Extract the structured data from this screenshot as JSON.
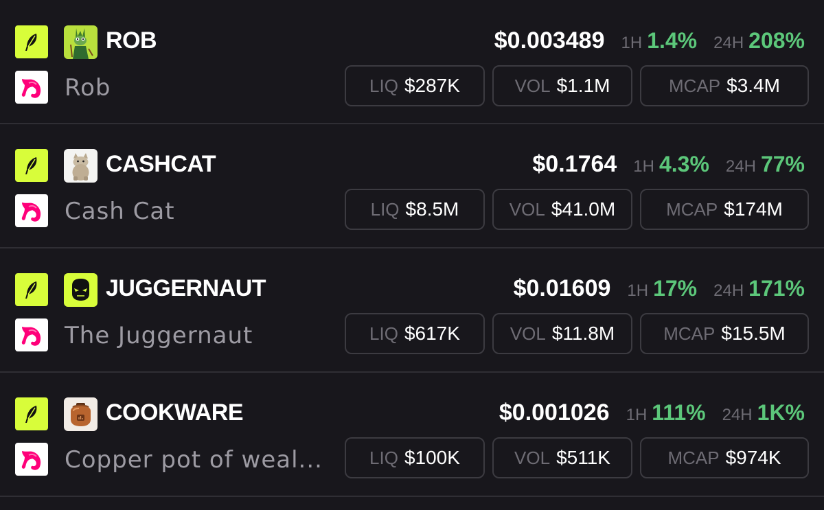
{
  "colors": {
    "background": "#18171c",
    "positive": "#5cc77a",
    "chain_badge": "#d8fd3a",
    "dex_pink": "#ff007a",
    "muted_text": "#9d9ba3"
  },
  "labels": {
    "h1": "1H",
    "h24": "24H",
    "liq": "LIQ",
    "vol": "VOL",
    "mcap": "MCAP"
  },
  "tokens": [
    {
      "symbol": "ROB",
      "name": "Rob",
      "price": "$0.003489",
      "change_1h": "1.4%",
      "change_24h": "208%",
      "liq": "$287K",
      "vol": "$1.1M",
      "mcap": "$3.4M",
      "chain_icon": "feather-icon",
      "dex_icon": "unicorn-icon",
      "avatar": "frog-archer-avatar"
    },
    {
      "symbol": "CASHCAT",
      "name": "Cash Cat",
      "price": "$0.1764",
      "change_1h": "4.3%",
      "change_24h": "77%",
      "liq": "$8.5M",
      "vol": "$41.0M",
      "mcap": "$174M",
      "chain_icon": "feather-icon",
      "dex_icon": "unicorn-icon",
      "avatar": "cat-avatar"
    },
    {
      "symbol": "JUGGERNAUT",
      "name": "The Juggernaut",
      "price": "$0.01609",
      "change_1h": "17%",
      "change_24h": "171%",
      "liq": "$617K",
      "vol": "$11.8M",
      "mcap": "$15.5M",
      "chain_icon": "feather-icon",
      "dex_icon": "unicorn-icon",
      "avatar": "juggernaut-avatar"
    },
    {
      "symbol": "COOKWARE",
      "name": "Copper pot of weal...",
      "price": "$0.001026",
      "change_1h": "111%",
      "change_24h": "1K%",
      "liq": "$100K",
      "vol": "$511K",
      "mcap": "$974K",
      "chain_icon": "feather-icon",
      "dex_icon": "unicorn-icon",
      "avatar": "copper-pot-avatar"
    }
  ]
}
